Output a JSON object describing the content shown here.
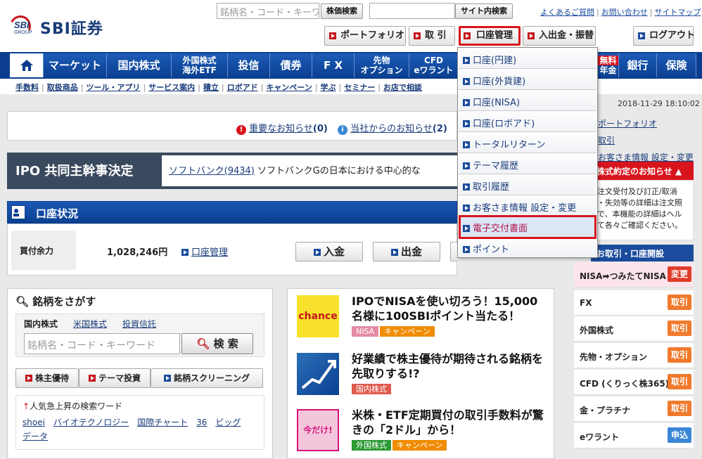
{
  "brand": {
    "sbi": "SBI",
    "group": "GROUP",
    "name": "SBI証券"
  },
  "search": {
    "placeholder": "銘柄名・コード・キーワード",
    "stock_button": "株価検索",
    "site_button": "サイト内検索"
  },
  "toplinks": [
    "よくあるご質問",
    "お問い合わせ",
    "サイトマップ"
  ],
  "header_buttons": {
    "portfolio": "ポートフォリオ",
    "trade": "取 引",
    "account": "口座管理",
    "deposit": "入出金・振替",
    "logout": "ログアウト"
  },
  "nav": {
    "market": "マーケット",
    "domestic": "国内株式",
    "foreign1": "外国株式",
    "foreign2": "海外ETF",
    "trust": "投信",
    "bond": "債券",
    "fx": "F X",
    "futures1": "先物",
    "futures2": "オプション",
    "cfd1": "CFD",
    "cfd2": "eワラント",
    "free": "無料",
    "pension": "年金",
    "bank": "銀行",
    "insurance": "保険"
  },
  "subnav": [
    "手数料",
    "取扱商品",
    "ツール・アプリ",
    "サービス案内",
    "積立",
    "ロボアド",
    "キャンペーン",
    "学ぶ",
    "セミナー",
    "お店で相談"
  ],
  "datetime": "2018-11-29 18:10:02",
  "notices": {
    "important": "重要なお知らせ",
    "important_count": "(0)",
    "company": "当社からのお知らせ",
    "company_count": "(2)"
  },
  "ipo": {
    "label": "IPO 共同主幹事決定",
    "link": "ソフトバンク(9434)",
    "text": " ソフトバンクGの日本における中心的な"
  },
  "account_status": {
    "title": "口座状況",
    "buying_power_label": "買付余力",
    "buying_power_value": "1,028,246円",
    "account_link": "口座管理",
    "deposit_button": "入金",
    "withdraw_button": "出金"
  },
  "dropdown": {
    "items": [
      "口座(円建)",
      "口座(外貨建)",
      "口座(NISA)",
      "口座(ロボアド)",
      "トータルリターン",
      "テーマ履歴",
      "取引履歴",
      "お客さま情報 設定・変更",
      "電子交付書面",
      "ポイント"
    ],
    "selected_index": 8
  },
  "right_links": [
    "ポートフォリオ",
    "取引",
    "お客さま情報 設定・変更"
  ],
  "stock_notice": {
    "title": "株式約定のお知らせ",
    "lines": [
      "注文受付及び訂正/取消",
      "・失効等の詳細は注文照",
      "で、本機能の詳細はヘル",
      "て各々ご確認ください。"
    ]
  },
  "open_accounts": {
    "title": "お取引・口座開設",
    "items": [
      {
        "label": "NISA➡つみたてNISA",
        "button": "変更"
      },
      {
        "label": "FX",
        "button": "取引"
      },
      {
        "label": "外国株式",
        "button": "取引"
      },
      {
        "label": "先物・オプション",
        "button": "取引"
      },
      {
        "label": "CFD (くりっく株365)",
        "button": "取引"
      },
      {
        "label": "金・プラチナ",
        "button": "取引"
      },
      {
        "label": "eワラント",
        "button": "申込"
      }
    ]
  },
  "stock_search": {
    "title": "銘柄をさがす",
    "tabs": [
      "国内株式",
      "米国株式",
      "投資信託"
    ],
    "placeholder": "銘柄名・コード・キーワード",
    "button": "検 索",
    "quick_buttons": [
      "株主優待",
      "テーマ投資",
      "銘柄スクリーニング"
    ],
    "trending_title": "人気急上昇の検索ワード",
    "trending": [
      "shoei",
      "バイオテクノロジー",
      "国際チャート",
      "36",
      "ビッグ",
      "データ"
    ]
  },
  "news": [
    {
      "thumb": "chance",
      "title": "IPOでNISAを使い切ろう！15,000名様に100SBIポイント当たる！",
      "tags": [
        "NISA",
        "キャンペーン"
      ]
    },
    {
      "thumb": "chart",
      "title": "好業績で株主優待が期待される銘柄を先取りする!?",
      "tags": [
        "国内株式"
      ]
    },
    {
      "thumb": "今だけ!",
      "title": "米株・ETF定期買付の取引手数料が驚きの「2ドル」から！",
      "tags": [
        "外国株式",
        "キャンペーン"
      ]
    }
  ]
}
